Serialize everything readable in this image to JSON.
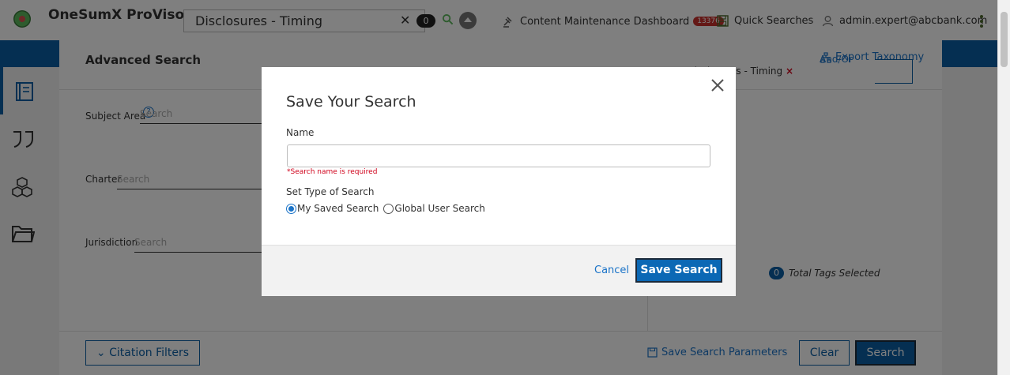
{
  "app": {
    "title": "OneSumX ProViso"
  },
  "topbar": {
    "search_value": "Disclosures - Timing",
    "result_count": "0",
    "dashboard_label": "Content Maintenance Dashboard",
    "dashboard_badge": "13376",
    "quick_searches_label": "Quick Searches",
    "user_label": "admin.expert@abcbank.com"
  },
  "rail": {
    "items": [
      "document-icon",
      "quote-icon",
      "cubes-icon",
      "folder-icon"
    ]
  },
  "advanced_search": {
    "title": "Advanced Search",
    "export_label": "Export Taxonomy",
    "fields": [
      {
        "label": "Subject Area",
        "placeholder": "Search"
      },
      {
        "label": "Charter",
        "placeholder": "Search"
      },
      {
        "label": "Jurisdiction",
        "placeholder": "Search"
      }
    ],
    "and_or": "And/Or",
    "selected_prefix": "t :",
    "selected_value": "Disclosures - Timing",
    "selected_remove": "×",
    "total_tags_count": "0",
    "total_tags_label": "Total Tags Selected",
    "citation_filters_label": "Citation Filters",
    "save_params_label": "Save Search Parameters",
    "clear_label": "Clear",
    "search_label": "Search"
  },
  "modal": {
    "title": "Save Your Search",
    "name_label": "Name",
    "name_value": "",
    "error_text": "*Search name is required",
    "type_label": "Set Type of Search",
    "option_my": "My Saved Search",
    "option_global": "Global User Search",
    "cancel_label": "Cancel",
    "save_label": "Save Search"
  },
  "colors": {
    "primary": "#0b5fa5",
    "link": "#1a73c8",
    "error": "#d0021b"
  }
}
